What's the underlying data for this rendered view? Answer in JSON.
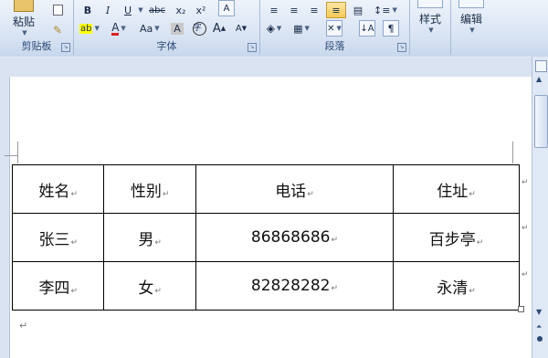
{
  "ribbon": {
    "clipboard": {
      "paste_label": "粘贴",
      "group_label": "剪贴板"
    },
    "font": {
      "group_label": "字体",
      "bold": "B",
      "italic": "I",
      "underline": "U",
      "strike": "abc",
      "subscript": "x₂",
      "superscript": "x²",
      "clear_format": "A",
      "highlight": "ab",
      "font_color": "A",
      "change_case": "Aa",
      "char_shading": "A",
      "enclose": "字",
      "grow": "A",
      "shrink": "A"
    },
    "paragraph": {
      "group_label": "段落"
    },
    "styles": {
      "label": "样式"
    },
    "editing": {
      "label": "编辑"
    }
  },
  "table": {
    "rows": [
      [
        "姓名",
        "性别",
        "电话",
        "住址"
      ],
      [
        "张三",
        "男",
        "86868686",
        "百步亭"
      ],
      [
        "李四",
        "女",
        "82828282",
        "永清"
      ]
    ]
  },
  "marks": {
    "paragraph": "↵"
  }
}
